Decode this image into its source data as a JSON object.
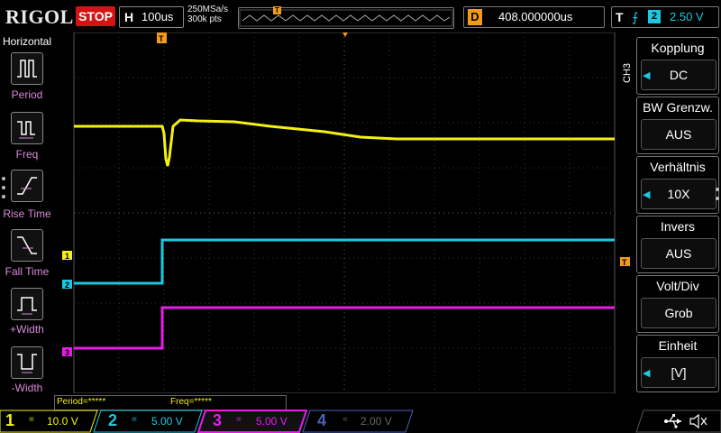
{
  "topbar": {
    "brand": "RIGOL",
    "run_state": "STOP",
    "timebase_label": "H",
    "timebase_value": "100us",
    "sample_rate": "250MSa/s",
    "memory_depth": "300k pts",
    "trigger_marker": "T",
    "delay_label": "D",
    "delay_value": "408.000000us",
    "trigger_label": "T",
    "trigger_edge": "⨍",
    "trigger_source": "2",
    "trigger_level": "2.50 V"
  },
  "left_menu": {
    "title": "Horizontal",
    "items": [
      {
        "label": "Period",
        "icon": "period-icon"
      },
      {
        "label": "Freq",
        "icon": "freq-icon"
      },
      {
        "label": "Rise Time",
        "icon": "rise-time-icon"
      },
      {
        "label": "Fall Time",
        "icon": "fall-time-icon"
      },
      {
        "label": "+Width",
        "icon": "pos-width-icon"
      },
      {
        "label": "-Width",
        "icon": "neg-width-icon"
      }
    ]
  },
  "right_menu": {
    "channel_tab": "CH3",
    "items": [
      {
        "title": "Kopplung",
        "value": "DC",
        "has_arrow": true
      },
      {
        "title": "BW Grenzw.",
        "value": "AUS",
        "has_arrow": false
      },
      {
        "title": "Verhältnis",
        "value": "10X",
        "has_arrow": true
      },
      {
        "title": "Invers",
        "value": "AUS",
        "has_arrow": false
      },
      {
        "title": "Volt/Div",
        "value": "Grob",
        "has_arrow": false
      },
      {
        "title": "Einheit",
        "value": "[V]",
        "has_arrow": true
      }
    ]
  },
  "measurements": {
    "period": "Period=*****",
    "freq": "Freq=*****"
  },
  "channels": [
    {
      "num": "1",
      "coupling": "=",
      "scale": "10.0 V",
      "color": "#f3f013",
      "active": true
    },
    {
      "num": "2",
      "coupling": "=",
      "scale": "5.00 V",
      "color": "#1cc8e0",
      "active": true
    },
    {
      "num": "3",
      "coupling": "=",
      "scale": "5.00 V",
      "color": "#e81ce8",
      "active": true
    },
    {
      "num": "4",
      "coupling": "=",
      "scale": "2.00 V",
      "color": "#4a60c0",
      "active": false
    }
  ],
  "markers": {
    "ch1": "1",
    "ch2": "2",
    "ch3": "3",
    "trigger_level": "T"
  },
  "status_icons": [
    "usb-icon",
    "speaker-muted-icon"
  ]
}
